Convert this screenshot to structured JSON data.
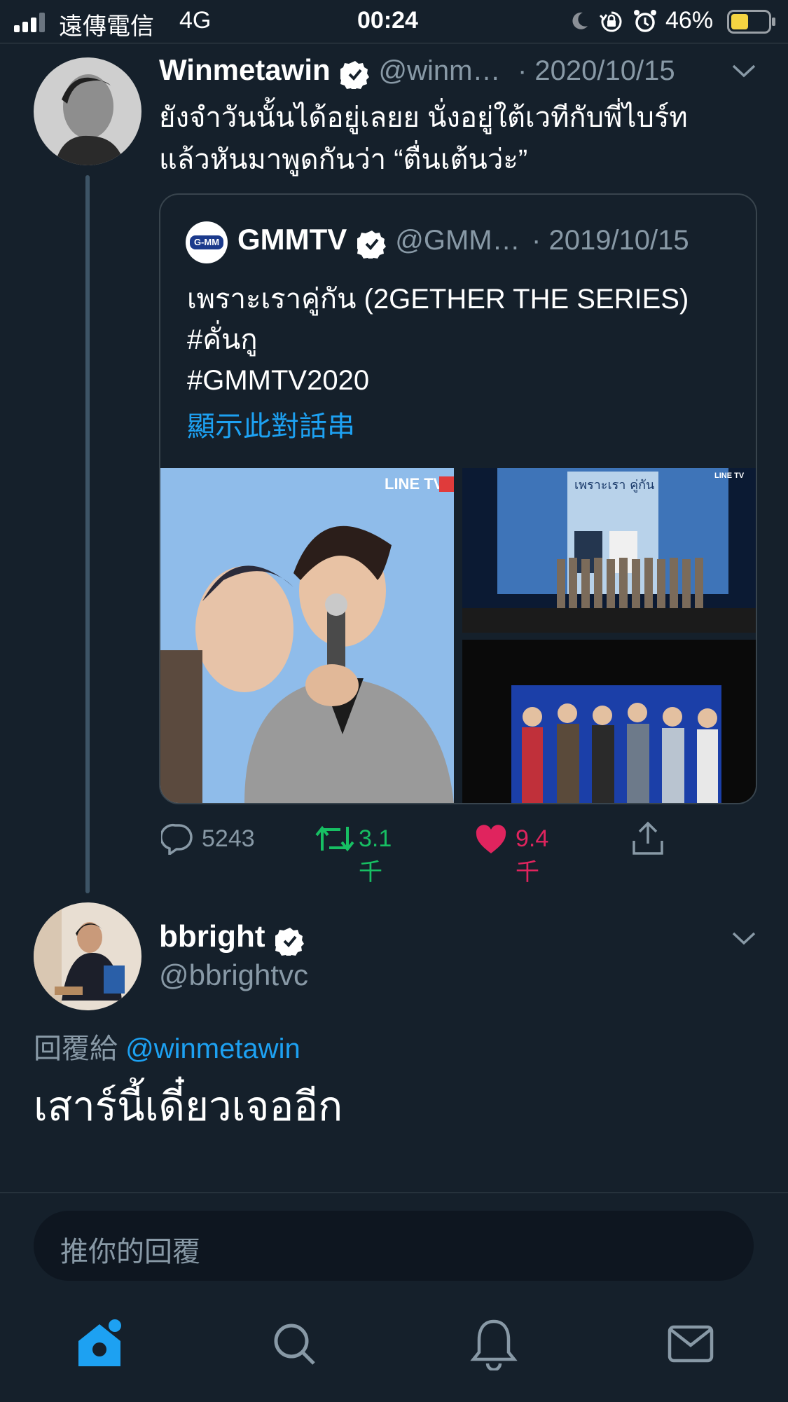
{
  "status_bar": {
    "carrier": "遠傳電信",
    "network": "4G",
    "time": "00:24",
    "battery": "46%"
  },
  "tweet": {
    "display_name": "Winmetawin",
    "handle": "@winm…",
    "date": "· 2020/10/15",
    "text_line1": "ยังจำวันนั้นได้อยู่เลยย นั่งอยู่ใต้เวทีกับพี่ไบร์ท",
    "text_line2": "แล้วหันมาพูดกันว่า “ตื่นเต้นว่ะ”",
    "quoted": {
      "display_name": "GMMTV",
      "handle": "@GMM…",
      "date": "· 2019/10/15",
      "line1": "เพราะเราคู่กัน (2GETHER THE SERIES)",
      "line2": "#คั่นกู",
      "line3": "#GMMTV2020",
      "show_thread": "顯示此對話串",
      "logo_text": "G-MM",
      "image_banner_1": "LINE TV",
      "image_banner_2": "LINE TV",
      "image_poster_text": "เพราะเรา คู่กัน"
    },
    "actions": {
      "replies": "5243",
      "retweets": "3.1千",
      "likes": "9.4千"
    },
    "colors": {
      "retweet": "#17bf63",
      "like": "#e0245e",
      "link": "#1da1f2"
    }
  },
  "reply": {
    "display_name": "bbright",
    "handle": "@bbrightvc",
    "replying_prefix": "回覆給",
    "replying_to": "@winmetawin",
    "text": "เสาร์นี้เดี๋ยวเจออีก"
  },
  "composer": {
    "placeholder": "推你的回覆"
  },
  "tab_bar": {
    "icons": [
      "home-icon",
      "search-icon",
      "notifications-icon",
      "messages-icon"
    ],
    "accent": "#1da1f2"
  }
}
